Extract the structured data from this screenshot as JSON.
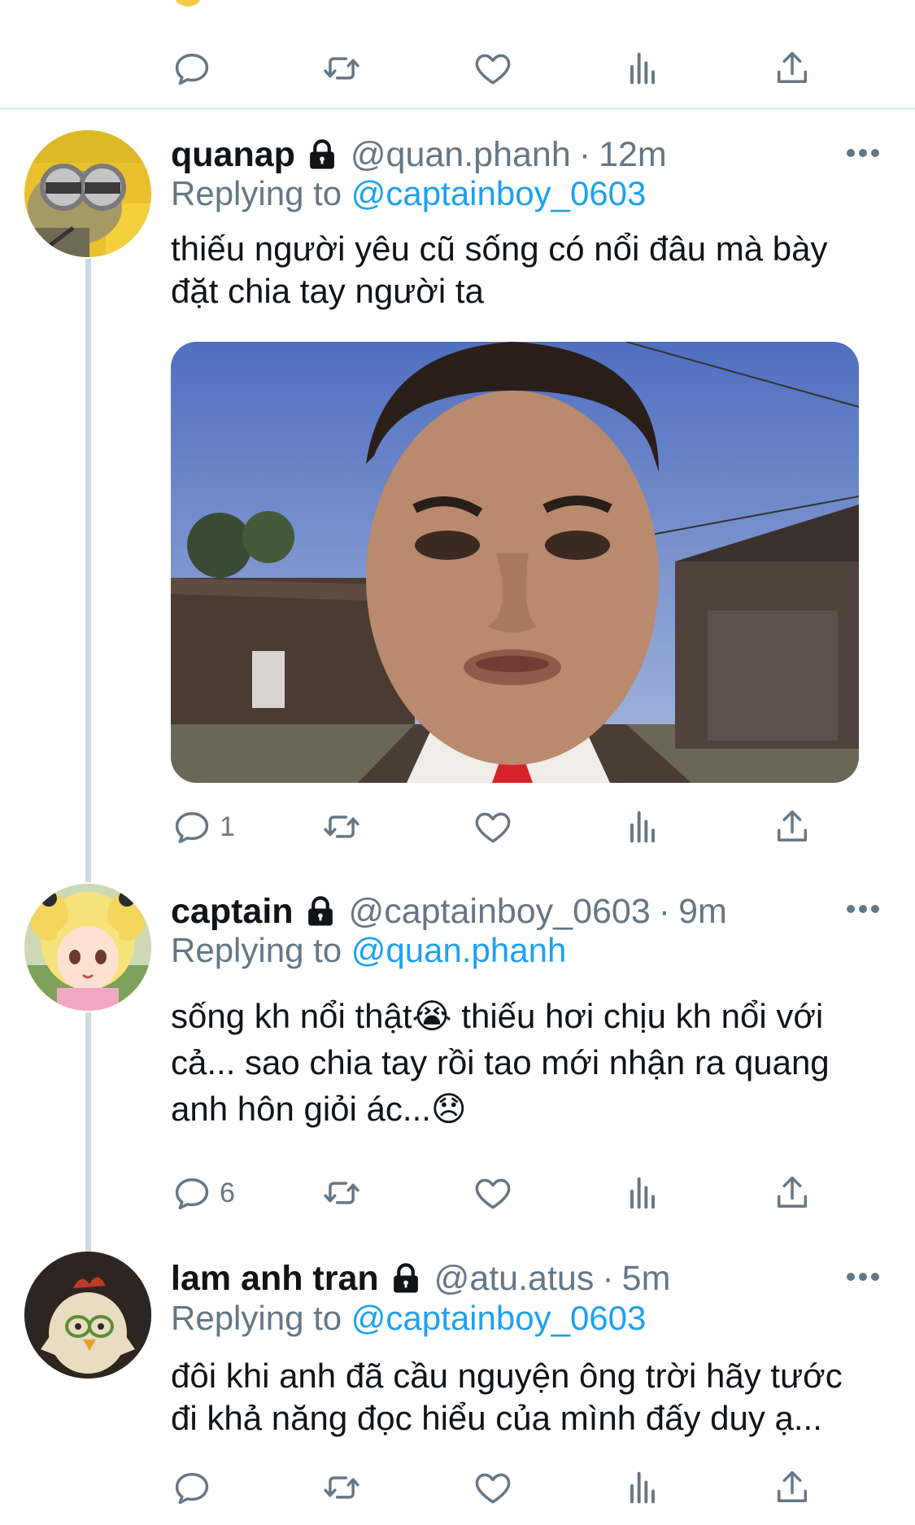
{
  "tweets": [
    {
      "name": "quanap",
      "handle": "@quan.phanh",
      "time": "12m",
      "replying_prefix": "Replying to",
      "replying_to": "@captainboy_0603",
      "text_lines": [
        "thiếu người yêu cũ sống có nổi đâu mà bày",
        "đặt chia tay người ta"
      ],
      "reply_count": "1"
    },
    {
      "name": "captain",
      "handle": "@captainboy_0603",
      "time": "9m",
      "replying_prefix": "Replying to",
      "replying_to": "@quan.phanh",
      "text_lines": [
        "sống kh nổi thật😭  thiếu hơi chịu kh nổi với",
        "cả... sao chia tay rồi tao mới nhận ra quang",
        "anh hôn giỏi ác...😞"
      ],
      "reply_count": "6"
    },
    {
      "name": "lam anh tran",
      "handle": "@atu.atus",
      "time": "5m",
      "replying_prefix": "Replying to",
      "replying_to": "@captainboy_0603",
      "text_lines": [
        "đôi khi anh đã cầu nguyện ông trời hãy tước",
        "đi khả năng đọc hiểu của mình đấy duy ạ..."
      ],
      "reply_count": ""
    }
  ],
  "separator": "·",
  "icons": {
    "reply": "reply-icon",
    "retweet": "retweet-icon",
    "like": "heart-icon",
    "analytics": "analytics-icon",
    "share": "share-icon",
    "lock": "lock-icon",
    "more": "more-icon"
  },
  "colors": {
    "mention": "#1da1f2",
    "secondary_text": "#657786",
    "divider": "#e6ecf0",
    "thread_line": "#cfd9de"
  }
}
